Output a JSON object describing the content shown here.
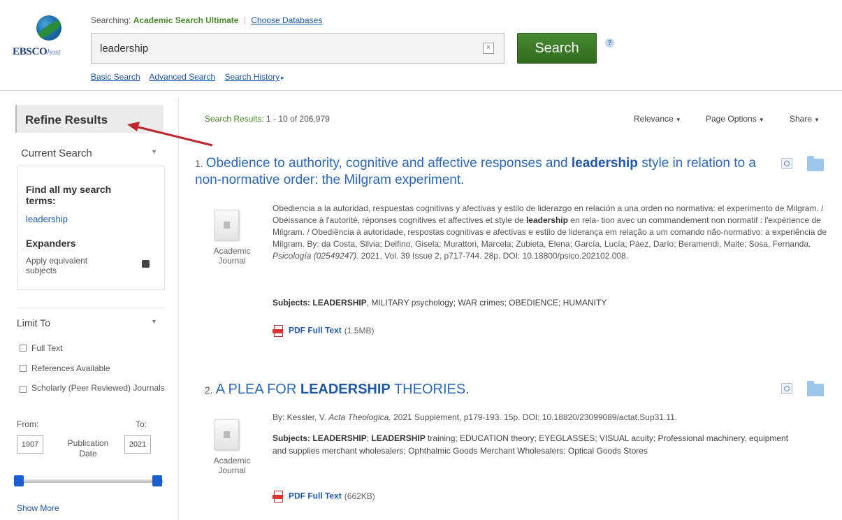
{
  "header": {
    "logo_text": "EBSCOhost",
    "searching_label": "Searching:",
    "database": "Academic Search Ultimate",
    "choose_databases": "Choose Databases",
    "search_value": "leadership",
    "search_button": "Search",
    "help": "?",
    "links": [
      "Basic Search",
      "Advanced Search",
      "Search History"
    ]
  },
  "sidebar": {
    "refine_title": "Refine Results",
    "current_search_title": "Current Search",
    "find_all_label": "Find all my search terms:",
    "search_term": "leadership",
    "expanders_label": "Expanders",
    "apply_equivalent": "Apply equivalent subjects",
    "limit_to_title": "Limit To",
    "limits": [
      "Full Text",
      "References Available",
      "Scholarly (Peer Reviewed) Journals"
    ],
    "from_label": "From:",
    "to_label": "To:",
    "from_value": "1907",
    "to_value": "2021",
    "publication_date": "Publication Date",
    "show_more": "Show More"
  },
  "results": {
    "label": "Search Results:",
    "range": "1 - 10 of 206,979",
    "tools": [
      "Relevance",
      "Page Options",
      "Share"
    ],
    "items": [
      {
        "number": "1.",
        "title_pre": "Obedience to authority, cognitive and affective responses and ",
        "title_hl": "leadership",
        "title_post": " style in relation to a non-normative order: the Milgram experiment.",
        "doc_type": "Academic Journal",
        "abstract_pre": "Obediencia a la autoridad, respuestas cognitivas y afectivas y estilo de liderazgo en relación a una orden no normativa: el experimento de Milgram. / Obéissance à l'autorité, réponses cognitives et affectives et style de ",
        "abstract_hl": "leadership",
        "abstract_mid": " en rela- tion avec un commandement non normatif : l'expérience de Milgram. / Obediência à autoridade, respostas cognitivas e afectivas e estilo de liderança em relação a um comando não-normativo: a experiência de Milgram. By: da Costa, Silvia; Delfino, Gisela; Murattori, Marcela; Zubieta, Elena; García, Lucía; Páez, Darío; Beramendi, Maite; Sosa, Fernanda. ",
        "abstract_journal": "Psicología (02549247).",
        "abstract_post": " 2021, Vol. 39 Issue 2, p717-744. 28p. DOI: 10.18800/psico.202102.008.",
        "subjects_label": "Subjects:",
        "subjects_hl": "LEADERSHIP",
        "subjects_rest": ", MILITARY psychology; WAR crimes; OBEDIENCE; HUMANITY",
        "pdf_label": "PDF Full Text",
        "pdf_size": "(1.5MB)"
      },
      {
        "number": "2.",
        "title_pre": "A PLEA FOR ",
        "title_hl": "LEADERSHIP",
        "title_post": " THEORIES.",
        "doc_type": "Academic Journal",
        "byline_pre": "By: Kessler, V. ",
        "byline_journal": "Acta Theologica.",
        "byline_post": " 2021 Supplement, p179-193. 15p. DOI: 10.18820/23099089/actat.Sup31.11.",
        "subjects_label": "Subjects:",
        "subjects_hl": "LEADERSHIP",
        "subjects_sep": "; ",
        "subjects_hl2": "LEADERSHIP",
        "subjects_rest": " training; EDUCATION theory; EYEGLASSES; VISUAL acuity; Professional machinery, equipment and supplies merchant wholesalers; Ophthalmic Goods Merchant Wholesalers; Optical Goods Stores",
        "pdf_label": "PDF Full Text",
        "pdf_size": "(662KB)"
      }
    ]
  },
  "colors": {
    "link": "#1a57a6",
    "search_button": "#3c7a28",
    "annotation_arrow": "#c0262d"
  }
}
